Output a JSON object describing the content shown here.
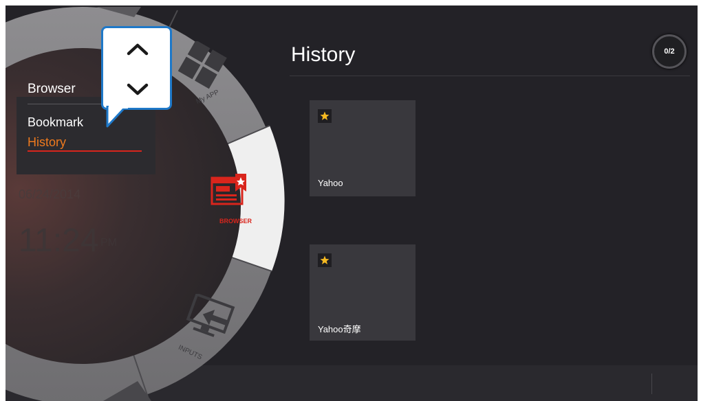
{
  "menu": {
    "title": "Browser",
    "items": [
      {
        "label": "Bookmark",
        "active": false
      },
      {
        "label": "History",
        "active": true
      }
    ]
  },
  "clock": {
    "date": "06/24/2014",
    "time": "11:24",
    "ampm": "PM"
  },
  "wheel": {
    "segments": [
      {
        "label": "My APP",
        "icon": "apps-grid-icon"
      },
      {
        "label": "BROWSER",
        "icon": "browser-bookmark-icon",
        "selected": true
      },
      {
        "label": "INPUTS",
        "icon": "input-source-icon"
      }
    ]
  },
  "popup": {
    "up_icon": "chevron-up-icon",
    "down_icon": "chevron-down-icon"
  },
  "history": {
    "title": "History",
    "page_indicator": "0/2",
    "items": [
      {
        "label": "Yahoo",
        "favorite": true
      },
      {
        "label": "Yahoo奇摩",
        "favorite": true
      }
    ]
  },
  "colors": {
    "accent": "#ee7a1e",
    "brand_red": "#d9251c",
    "popup_border": "#1e78c8",
    "star": "#f5b921"
  }
}
